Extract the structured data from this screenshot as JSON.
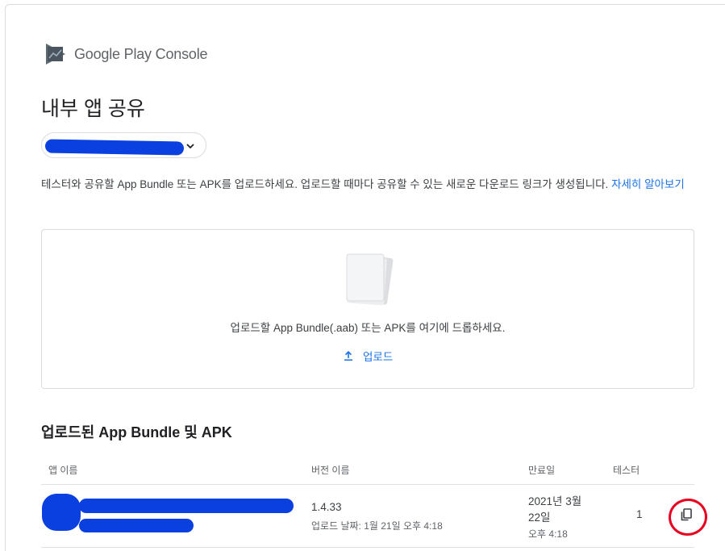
{
  "brand": {
    "name": "Google Play Console",
    "icon": "play-console-logo"
  },
  "page": {
    "title": "내부 앱 공유",
    "description": "테스터와 공유할 App Bundle 또는 APK를 업로드하세요. 업로드할 때마다 공유할 수 있는 새로운 다운로드 링크가 생성됩니다.",
    "learn_more": "자세히 알아보기"
  },
  "app_selector": {
    "icon": "chevron-down-icon"
  },
  "dropzone": {
    "text": "업로드할 App Bundle(.aab) 또는 APK를 여기에 드롭하세요.",
    "upload_label": "업로드",
    "upload_icon": "upload-icon"
  },
  "uploads": {
    "title": "업로드된 App Bundle 및 APK",
    "columns": [
      "앱 이름",
      "버전 이름",
      "만료일",
      "테스터"
    ],
    "rows": [
      {
        "version": "1.4.33",
        "uploaded": "업로드 날짜: 1월 21일 오후 4:18",
        "expiry_date_line1": "2021년 3월",
        "expiry_date_line2": "22일",
        "expiry_time": "오후 4:18",
        "testers": "1",
        "action_icon": "copy-icon"
      }
    ]
  },
  "colors": {
    "accent": "#1a73e8",
    "redaction": "#0a3fe0",
    "highlight": "#e8001e"
  }
}
